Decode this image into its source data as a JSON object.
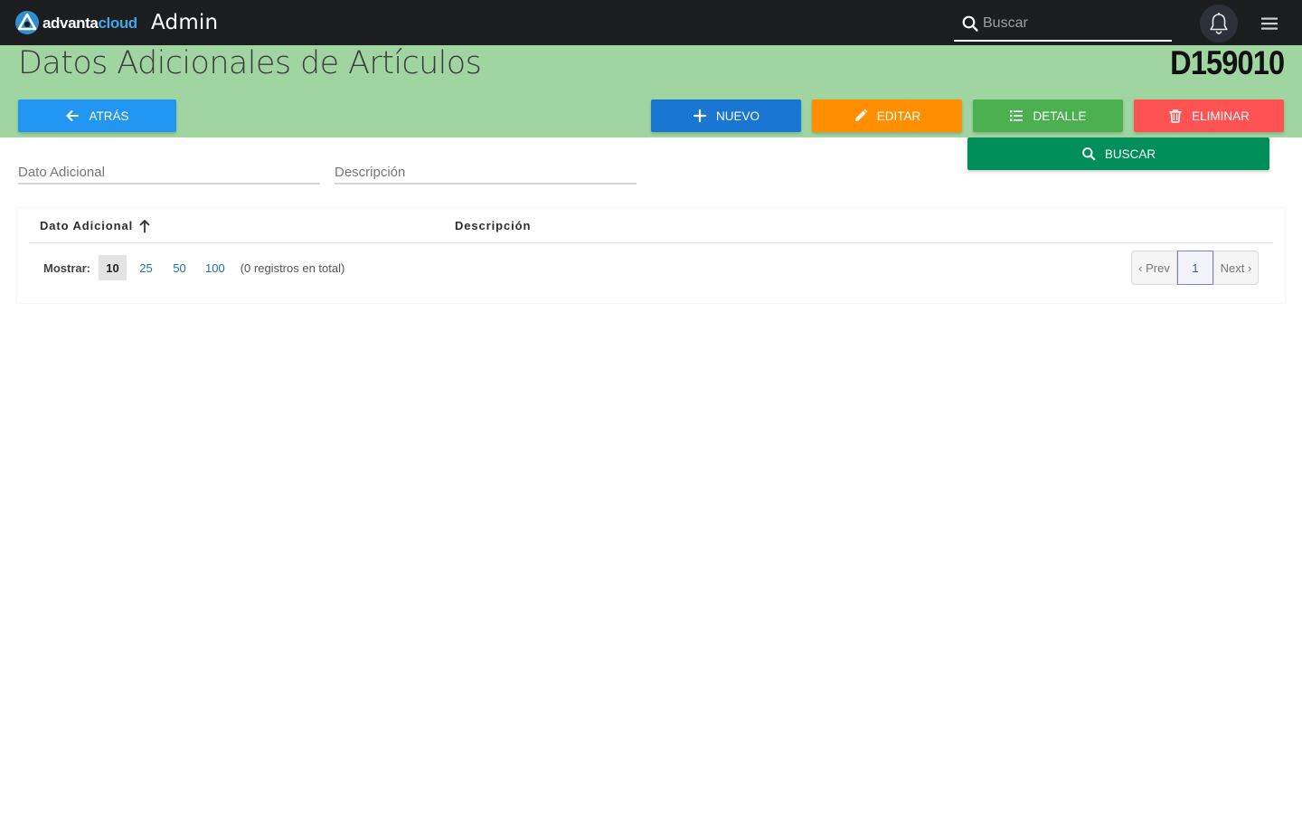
{
  "navbar": {
    "brand_part1": "advanta",
    "brand_part2": "cloud",
    "app_title": "Admin",
    "search_placeholder": "Buscar",
    "bell_icon": "bell-icon",
    "menu_icon": "hamburger-menu-icon"
  },
  "header": {
    "title": "Datos Adicionales de Artículos",
    "code": "D159010",
    "buttons": {
      "back": "Atrás",
      "new": "Nuevo",
      "edit": "Editar",
      "detail": "Detalle",
      "delete": "Eliminar"
    },
    "colors": {
      "header_bg": "#a0d5a1",
      "back": "#2196f3",
      "new": "#1976d2",
      "edit": "#ff8f00",
      "detail": "#4caf50",
      "delete": "#ff5252",
      "search": "#008f5a"
    }
  },
  "filters": {
    "dato_adicional_placeholder": "Dato Adicional",
    "descripcion_placeholder": "Descripción",
    "search_button": "Buscar"
  },
  "table": {
    "columns": [
      {
        "label": "Dato Adicional",
        "sort": "ascending"
      },
      {
        "label": "Descripción"
      }
    ],
    "rows": []
  },
  "pagination": {
    "show_label": "Mostrar:",
    "page_sizes": [
      "10",
      "25",
      "50",
      "100"
    ],
    "selected_page_size": "10",
    "total_text": "(0 registros en total)",
    "prev_label": "‹ Prev",
    "current_page": "1",
    "next_label": "Next ›"
  }
}
